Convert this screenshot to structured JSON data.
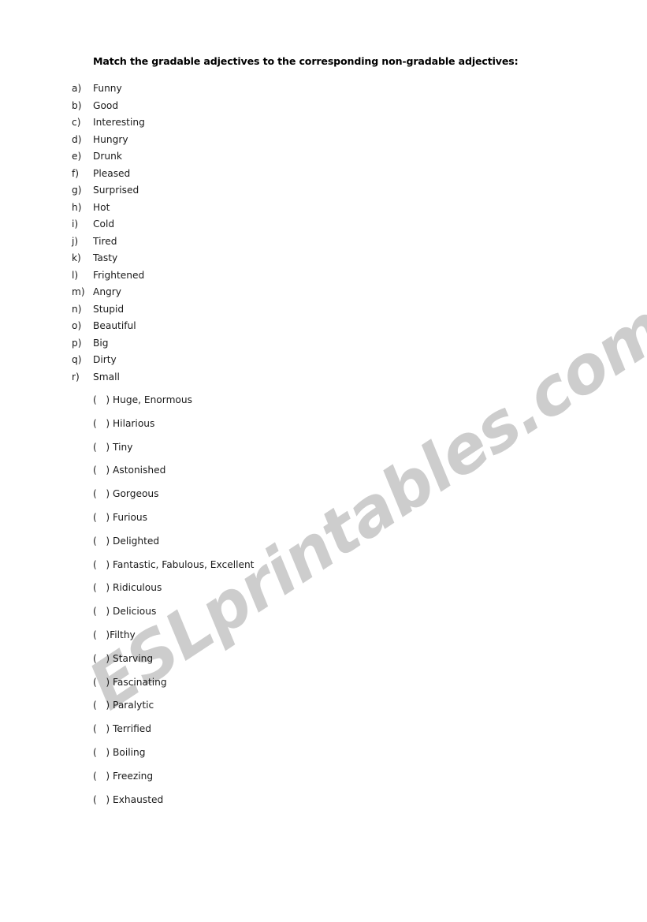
{
  "document": {
    "title": "Match the gradable adjectives to the corresponding non-gradable adjectives:",
    "background_color": "#ffffff",
    "text_color": "#1a1a1a"
  },
  "watermark": {
    "text": "ESLprintables.com",
    "color": "#cdcdcd",
    "rotation_degrees": -33.5
  },
  "gradable_adjectives": [
    {
      "marker": "a)",
      "term": "Funny"
    },
    {
      "marker": "b)",
      "term": "Good"
    },
    {
      "marker": "c)",
      "term": "Interesting"
    },
    {
      "marker": "d)",
      "term": "Hungry"
    },
    {
      "marker": "e)",
      "term": "Drunk"
    },
    {
      "marker": "f)",
      "term": "Pleased"
    },
    {
      "marker": "g)",
      "term": "Surprised"
    },
    {
      "marker": "h)",
      "term": "Hot"
    },
    {
      "marker": "i)",
      "term": "Cold"
    },
    {
      "marker": "j)",
      "term": "Tired"
    },
    {
      "marker": "k)",
      "term": "Tasty"
    },
    {
      "marker": "l)",
      "term": "Frightened"
    },
    {
      "marker": "m)",
      "term": "Angry"
    },
    {
      "marker": "n)",
      "term": "Stupid"
    },
    {
      "marker": "o)",
      "term": "Beautiful"
    },
    {
      "marker": "p)",
      "term": "Big"
    },
    {
      "marker": "q)",
      "term": "Dirty"
    },
    {
      "marker": "r)",
      "term": "Small"
    }
  ],
  "non_gradable_adjectives": [
    {
      "blank": "(   ) ",
      "term": "Huge, Enormous"
    },
    {
      "blank": "(   ) ",
      "term": "Hilarious"
    },
    {
      "blank": "(   ) ",
      "term": "Tiny"
    },
    {
      "blank": "(   ) ",
      "term": "Astonished"
    },
    {
      "blank": "(   ) ",
      "term": "Gorgeous"
    },
    {
      "blank": "(   ) ",
      "term": "Furious"
    },
    {
      "blank": "(   ) ",
      "term": "Delighted"
    },
    {
      "blank": "(   ) ",
      "term": "Fantastic, Fabulous, Excellent"
    },
    {
      "blank": "(   ) ",
      "term": "Ridiculous"
    },
    {
      "blank": "(   ) ",
      "term": "Delicious"
    },
    {
      "blank": "(   )",
      "term": "Filthy"
    },
    {
      "blank": "(   ) ",
      "term": "Starving"
    },
    {
      "blank": "(   ) ",
      "term": "Fascinating"
    },
    {
      "blank": "(   ) ",
      "term": "Paralytic"
    },
    {
      "blank": "(   ) ",
      "term": "Terrified"
    },
    {
      "blank": "(   ) ",
      "term": "Boiling"
    },
    {
      "blank": "(   ) ",
      "term": "Freezing"
    },
    {
      "blank": "(   ) ",
      "term": "Exhausted"
    }
  ]
}
